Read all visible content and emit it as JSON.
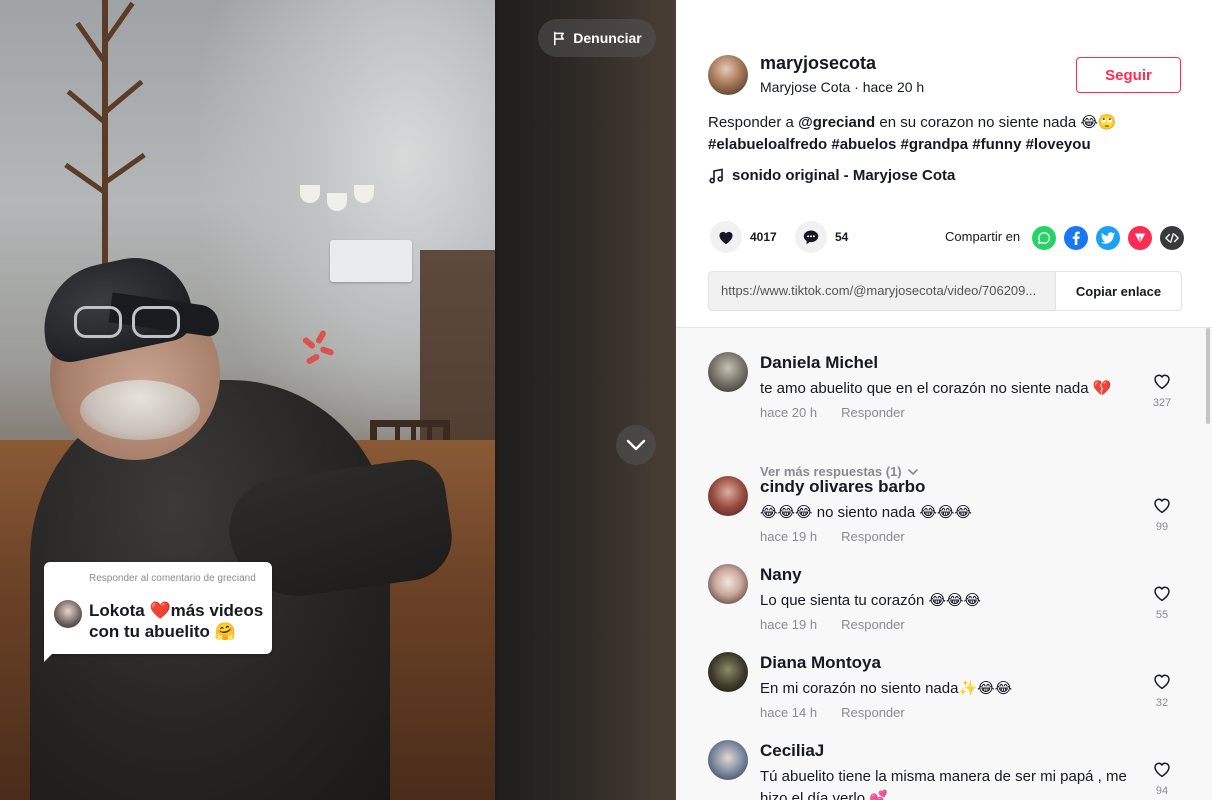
{
  "video": {
    "report_label": "Denunciar",
    "sticker": {
      "header": "Responder al comentario de greciand",
      "text": "Lokota ❤️más videos con tu abuelito 🤗"
    }
  },
  "author": {
    "username": "maryjosecota",
    "subtitle": "Maryjose Cota · hace 20 h",
    "follow_label": "Seguir"
  },
  "caption": {
    "prefix": "Responder a ",
    "mention": "@greciand",
    "text": " en su corazon no siente nada 😂🙄",
    "hashtags": "#elabueloalfredo #abuelos #grandpa #funny #loveyou"
  },
  "sound": {
    "label": "sonido original - Maryjose Cota"
  },
  "stats": {
    "likes": "4017",
    "comments": "54",
    "share_label": "Compartir en"
  },
  "share_icons": [
    {
      "name": "whatsapp-icon",
      "color": "#25d366"
    },
    {
      "name": "facebook-icon",
      "color": "#1877f2"
    },
    {
      "name": "twitter-icon",
      "color": "#1da1f2"
    },
    {
      "name": "send-icon",
      "color": "#fe2c55"
    },
    {
      "name": "embed-icon",
      "color": "#3a3a3c"
    }
  ],
  "link": {
    "url": "https://www.tiktok.com/@maryjosecota/video/706209...",
    "copy_label": "Copiar enlace"
  },
  "comments": [
    {
      "user": "Daniela Michel",
      "text": "te amo abuelito que en el corazón no siente nada 💔",
      "time": "hace 20 h",
      "reply": "Responder",
      "likes": "327",
      "more": "Ver más respuestas (1)"
    },
    {
      "user": "cindy olivares barbo",
      "text": "😂😂😂 no siento nada 😂😂😂",
      "time": "hace 19 h",
      "reply": "Responder",
      "likes": "99"
    },
    {
      "user": "Nany",
      "text": "Lo que sienta tu corazón 😂😂😂",
      "time": "hace 19 h",
      "reply": "Responder",
      "likes": "55"
    },
    {
      "user": "Diana Montoya",
      "text": "En mi corazón no siento nada✨😂😂",
      "time": "hace 14 h",
      "reply": "Responder",
      "likes": "32"
    },
    {
      "user": "CeciliaJ",
      "text": "Tú abuelito tiene la misma manera de ser mi papá , me hizo el día verlo 💕",
      "likes": "94"
    }
  ]
}
